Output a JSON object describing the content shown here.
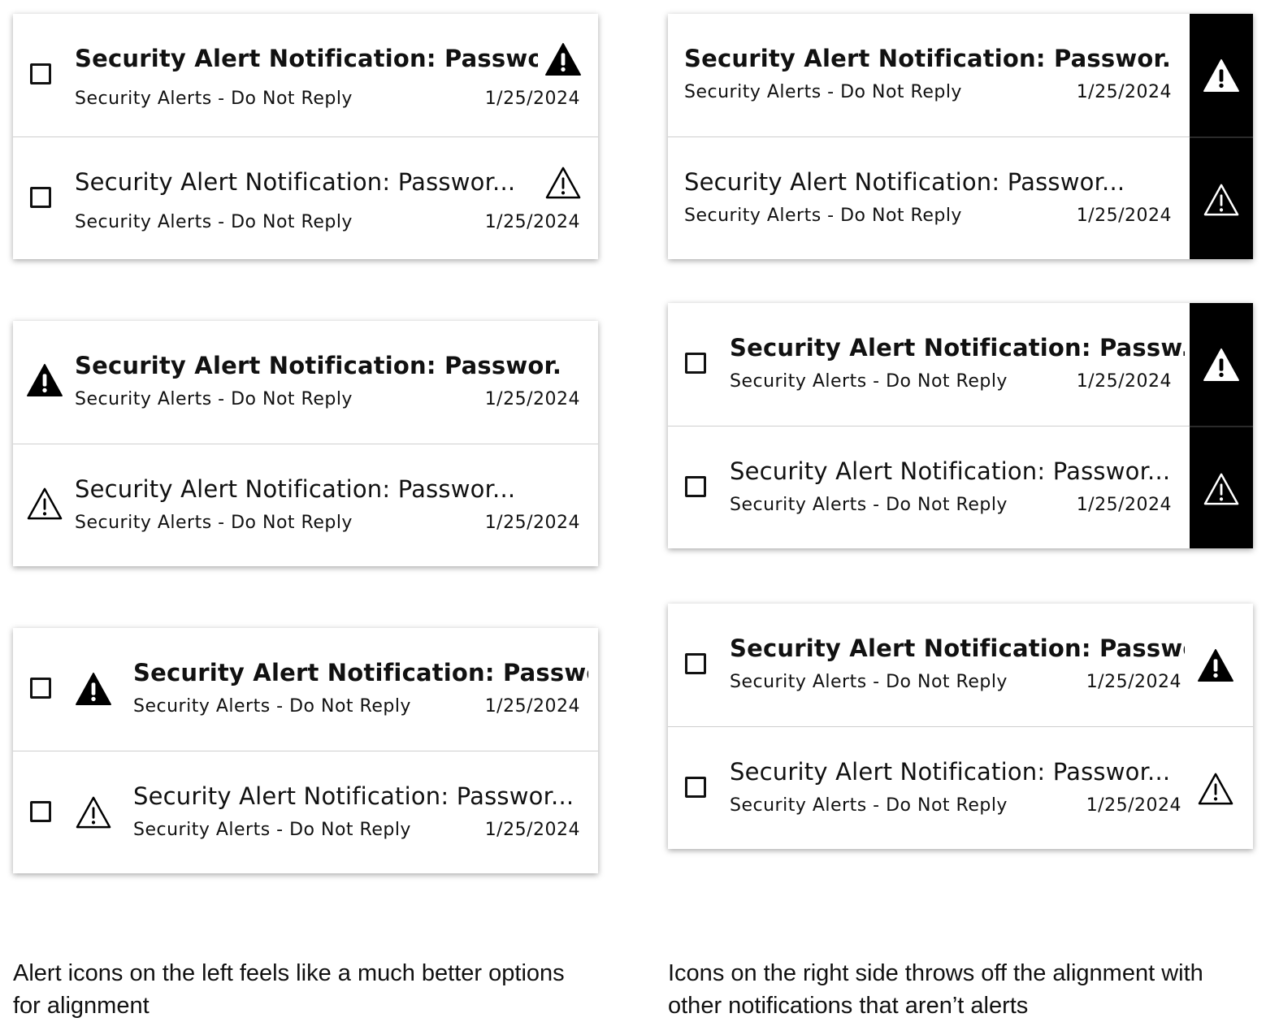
{
  "notification": {
    "title_full": "Security Alert Notification: Passwor...",
    "title_short": "Security Alert Notification: Passw...",
    "sender": "Security Alerts - Do Not Reply",
    "date": "1/25/2024"
  },
  "icons": {
    "unread": "warning-filled-icon",
    "read": "warning-outline-icon"
  },
  "captions": {
    "left": "Alert icons on the left feels like a much better options for alignment",
    "right": "Icons on the right side throws off the alignment with other notifications that aren’t alerts"
  }
}
